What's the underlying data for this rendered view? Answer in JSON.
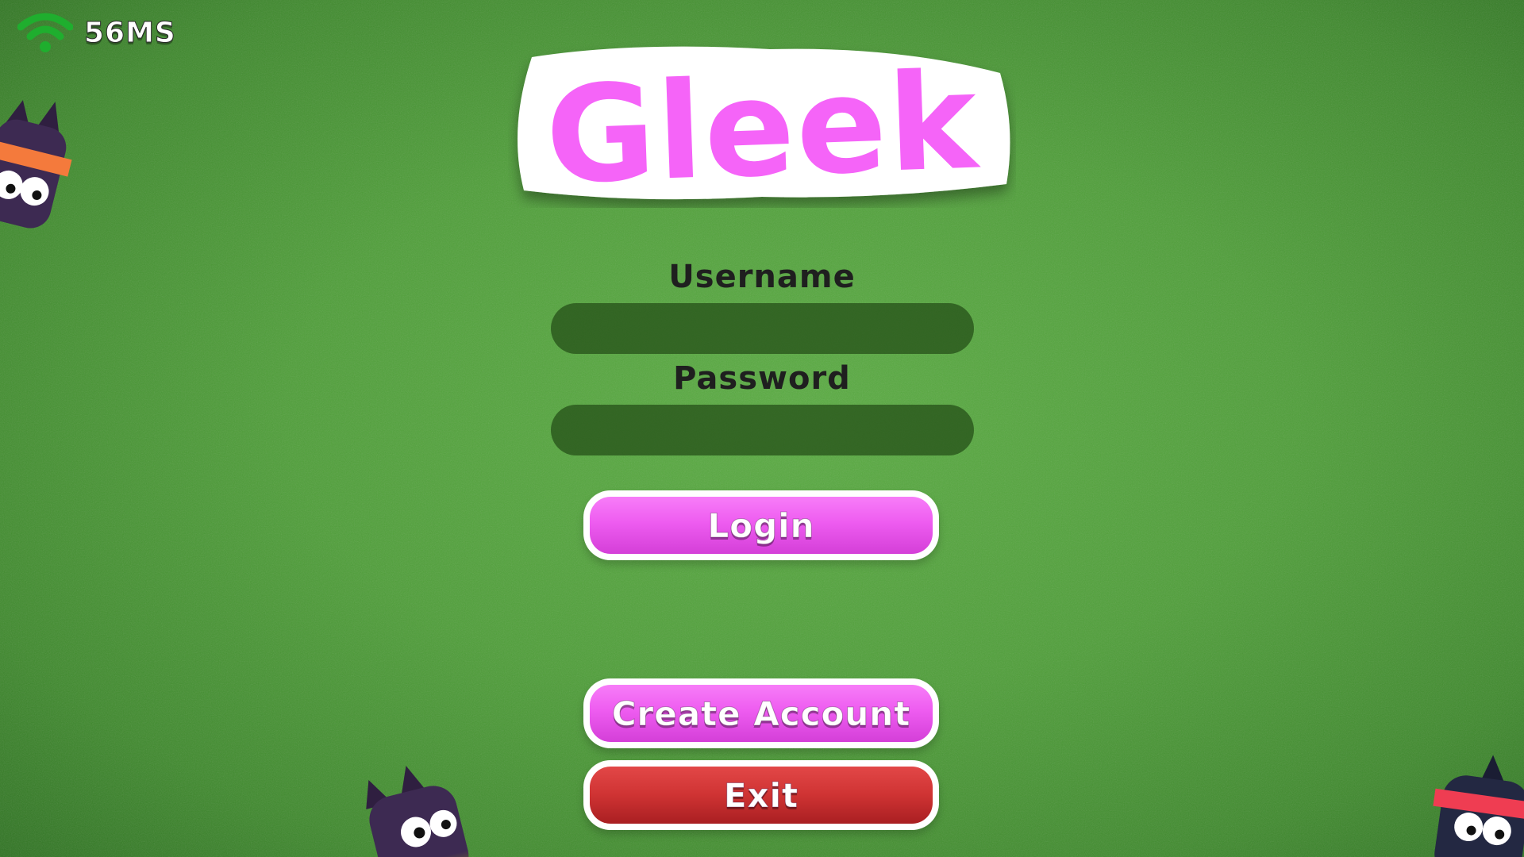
{
  "game_title": "Gleek",
  "network": {
    "ping": "56MS",
    "icon": "wifi-icon",
    "color": "#1fae2e"
  },
  "login_form": {
    "username_label": "Username",
    "username_value": "",
    "password_label": "Password",
    "password_value": ""
  },
  "buttons": {
    "login": "Login",
    "create_account": "Create Account",
    "exit": "Exit"
  },
  "colors": {
    "background": "#4f9f39",
    "logo_fill": "#f564f8",
    "button_pink": "#ee5cf0",
    "button_red": "#cf3333",
    "input_bg": "#2e5f1f",
    "label_text": "#1f1f1f"
  },
  "mascots": [
    {
      "name": "ninja-cat",
      "headband": "#f47a3c",
      "body": "#3d2a52"
    },
    {
      "name": "cat",
      "headband": "",
      "body": "#3d2a52"
    },
    {
      "name": "ninja-cat",
      "headband": "#ef3d52",
      "body": "#232842"
    }
  ]
}
